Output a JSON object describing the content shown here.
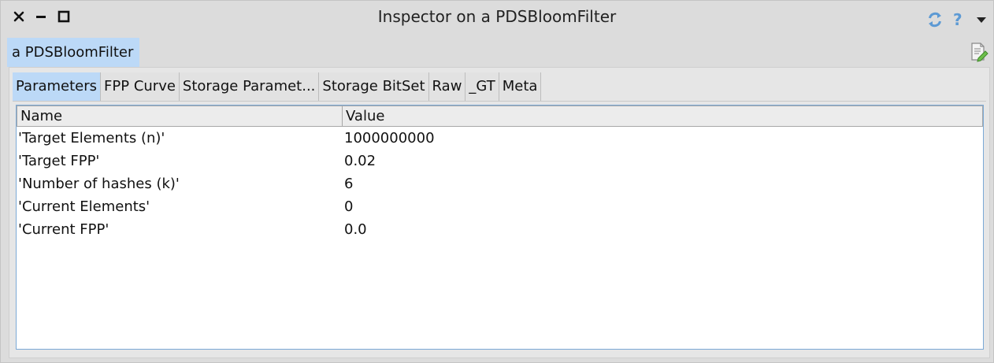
{
  "window": {
    "title": "Inspector on a PDSBloomFilter",
    "help_label": "?"
  },
  "outer_tab": {
    "label": "a PDSBloomFilter"
  },
  "subtabs": [
    {
      "label": "Parameters",
      "active": true
    },
    {
      "label": "FPP Curve"
    },
    {
      "label": "Storage Paramet..."
    },
    {
      "label": "Storage BitSet"
    },
    {
      "label": "Raw"
    },
    {
      "label": "_GT"
    },
    {
      "label": "Meta"
    }
  ],
  "table": {
    "columns": [
      "Name",
      "Value"
    ],
    "rows": [
      {
        "name": "'Target Elements (n)'",
        "value": "1000000000"
      },
      {
        "name": "'Target FPP'",
        "value": "0.02"
      },
      {
        "name": "'Number of hashes (k)'",
        "value": "6"
      },
      {
        "name": "'Current Elements'",
        "value": "0"
      },
      {
        "name": "'Current FPP'",
        "value": "0.0"
      }
    ]
  },
  "colors": {
    "selection": "#bcd9f7",
    "accent": "#5d9ad4",
    "table_border": "#7ba9d6"
  },
  "icons": [
    "close-icon",
    "minimize-icon",
    "maximize-icon",
    "refresh-icon",
    "help-icon",
    "dropdown-arrow-icon",
    "edit-icon"
  ]
}
